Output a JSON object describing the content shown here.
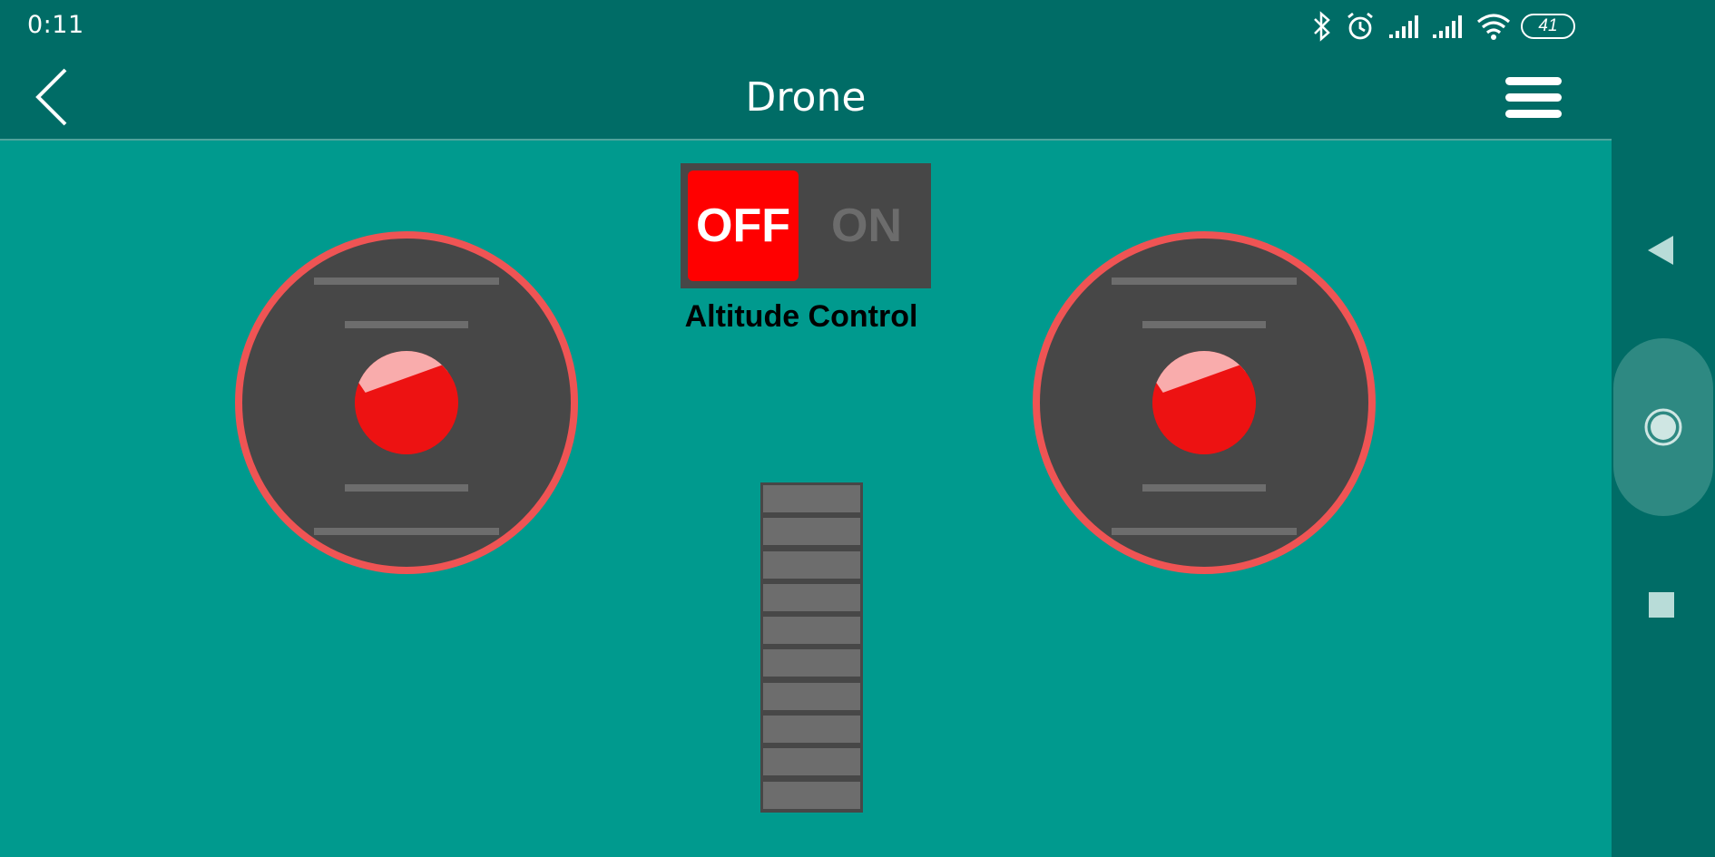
{
  "status_bar": {
    "time": "0:11",
    "battery": "41",
    "icons": [
      "bluetooth-icon",
      "alarm-icon",
      "signal-icon",
      "signal-icon",
      "wifi-icon",
      "battery-icon"
    ]
  },
  "app_bar": {
    "title": "Drone",
    "back_icon": "chevron-left-icon",
    "menu_icon": "hamburger-menu-icon"
  },
  "toggle": {
    "off_label": "OFF",
    "on_label": "ON",
    "caption": "Altitude Control",
    "state": "off",
    "active_color": "#ff0000"
  },
  "joysticks": {
    "left": {
      "border_color": "#ef5454",
      "knob_color": "#ed1212"
    },
    "right": {
      "border_color": "#ef5454",
      "knob_color": "#ed1212"
    }
  },
  "throttle_slider": {
    "segments": 10,
    "level": 0
  },
  "nav_bar": {
    "back_icon": "triangle-back-icon",
    "home_icon": "circle-home-icon",
    "recents_icon": "square-recents-icon"
  },
  "colors": {
    "primary_dark": "#006c66",
    "background": "#009a8e"
  }
}
